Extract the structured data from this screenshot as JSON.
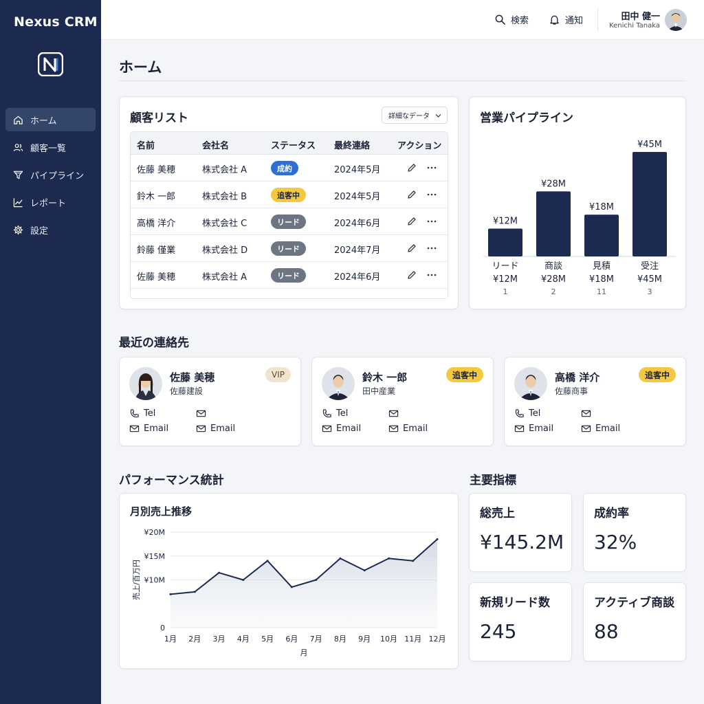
{
  "app": {
    "name": "Nexus CRM"
  },
  "sidebar": {
    "items": [
      {
        "label": "ホーム",
        "icon": "home-icon"
      },
      {
        "label": "顧客一覧",
        "icon": "users-icon"
      },
      {
        "label": "パイプライン",
        "icon": "funnel-icon"
      },
      {
        "label": "レポート",
        "icon": "chart-line-icon"
      },
      {
        "label": "設定",
        "icon": "gear-icon"
      }
    ]
  },
  "topbar": {
    "search_label": "検索",
    "notify_label": "通知",
    "user_name": "田中 健一",
    "user_romaji": "Kenichi Tanaka"
  },
  "page": {
    "title": "ホーム"
  },
  "customers": {
    "title": "顧客リスト",
    "filter_label": "詳細なデータ",
    "columns": [
      "名前",
      "会社名",
      "ステータス",
      "最終連絡",
      "アクション"
    ],
    "rows": [
      {
        "name": "佐藤 美穂",
        "company": "株式会社 A",
        "status": "成約",
        "last": "2024年5月"
      },
      {
        "name": "鈴木 一郎",
        "company": "株式会社 B",
        "status": "追客中",
        "last": "2024年5月"
      },
      {
        "name": "高橋 洋介",
        "company": "株式会社 C",
        "status": "リード",
        "last": "2024年6月"
      },
      {
        "name": "鈴藤 僅業",
        "company": "株式会社 D",
        "status": "リード",
        "last": "2024年7月"
      },
      {
        "name": "佐藤 美穂",
        "company": "株式会社 A",
        "status": "リード",
        "last": "2024年6月"
      }
    ],
    "status_colors": {
      "成約": "#2f6fd3",
      "追客中": "#f5c842",
      "リード": "#6d7482"
    }
  },
  "pipeline": {
    "title": "営業パイプライン",
    "chart_data": {
      "type": "bar",
      "categories": [
        "リード",
        "商談",
        "見積",
        "受注"
      ],
      "values": [
        12,
        28,
        18,
        45
      ],
      "value_labels": [
        "¥12M",
        "¥28M",
        "¥18M",
        "¥45M"
      ],
      "counts": [
        "1",
        "2",
        "11",
        "3"
      ],
      "unit": "M",
      "bar_color": "#1b2a4e",
      "ylim": [
        0,
        45
      ],
      "grid": false
    }
  },
  "contacts": {
    "title": "最近の連絡先",
    "tel_label": "Tel",
    "email_label": "Email",
    "items": [
      {
        "name": "佐藤 美穂",
        "company": "佐藤建設",
        "badge": "VIP"
      },
      {
        "name": "鈴木 一郎",
        "company": "田中産業",
        "badge": "追客中"
      },
      {
        "name": "高橋 洋介",
        "company": "佐藤商事",
        "badge": "追客中"
      }
    ]
  },
  "performance": {
    "title": "パフォーマンス統計",
    "chart_title": "月別売上推移",
    "chart_data": {
      "type": "area",
      "x": [
        "1月",
        "2月",
        "3月",
        "4月",
        "5月",
        "6月",
        "7月",
        "8月",
        "9月",
        "10月",
        "11月",
        "12月"
      ],
      "values": [
        7,
        7.5,
        11.5,
        10,
        14,
        8.5,
        10,
        14.5,
        12,
        14.5,
        14,
        18.5
      ],
      "xlabel": "月",
      "ylabel": "売上/百万円",
      "yticks": [
        0,
        10,
        15,
        20
      ],
      "ytick_labels": [
        "0",
        "¥10M",
        "¥15M",
        "¥20M"
      ],
      "ylim": [
        0,
        20
      ],
      "line_color": "#1b2a4e",
      "grid": true
    }
  },
  "kpi": {
    "title": "主要指標",
    "items": [
      {
        "label": "総売上",
        "value": "¥145.2M"
      },
      {
        "label": "成約率",
        "value": "32%"
      },
      {
        "label": "新規リード数",
        "value": "245"
      },
      {
        "label": "アクティブ商談",
        "value": "88"
      }
    ]
  }
}
